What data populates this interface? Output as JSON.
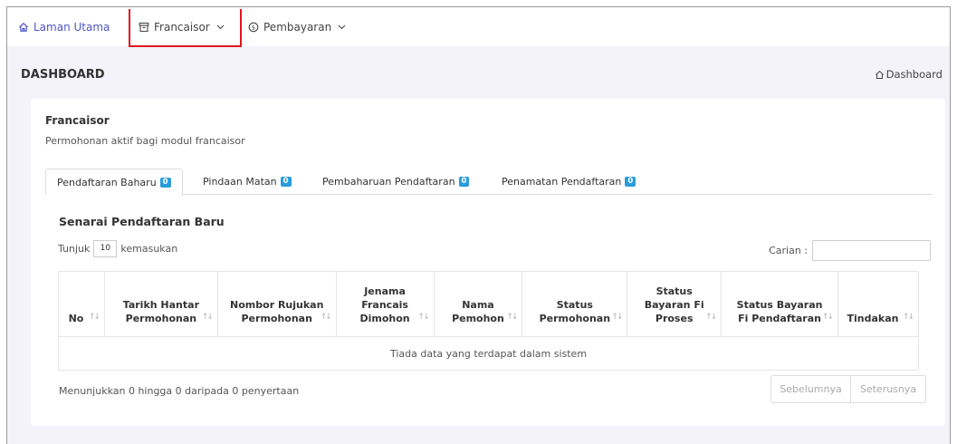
{
  "nav": {
    "home_label": "Laman Utama",
    "francaisor_label": "Francaisor",
    "pembayaran_label": "Pembayaran",
    "accent_color": "#4f55c5",
    "highlight_color": "#e0151e"
  },
  "header": {
    "title": "DASHBOARD",
    "breadcrumb": "Dashboard"
  },
  "card": {
    "title": "Francaisor",
    "subtitle": "Permohonan aktif bagi modul francaisor"
  },
  "tabs": [
    {
      "label": "Pendaftaran Baharu",
      "count": "0",
      "active": true
    },
    {
      "label": "Pindaan Matan",
      "count": "0",
      "active": false
    },
    {
      "label": "Pembaharuan Pendaftaran",
      "count": "0",
      "active": false
    },
    {
      "label": "Penamatan Pendaftaran",
      "count": "0",
      "active": false
    }
  ],
  "section": {
    "title": "Senarai Pendaftaran Baru"
  },
  "length": {
    "prefix": "Tunjuk",
    "value": "10",
    "suffix": "kemasukan"
  },
  "search": {
    "label": "Carian :",
    "value": ""
  },
  "table": {
    "columns": [
      {
        "l1": "",
        "l2": "",
        "l3": "No"
      },
      {
        "l1": "",
        "l2": "Tarikh Hantar",
        "l3": "Permohonan"
      },
      {
        "l1": "",
        "l2": "Nombor Rujukan",
        "l3": "Permohonan"
      },
      {
        "l1": "Jenama",
        "l2": "Francais",
        "l3": "Dimohon"
      },
      {
        "l1": "",
        "l2": "Nama",
        "l3": "Pemohon"
      },
      {
        "l1": "",
        "l2": "Status",
        "l3": "Permohonan"
      },
      {
        "l1": "Status",
        "l2": "Bayaran Fi",
        "l3": "Proses"
      },
      {
        "l1": "",
        "l2": "Status Bayaran",
        "l3": "Fi Pendaftaran"
      },
      {
        "l1": "",
        "l2": "",
        "l3": "Tindakan"
      }
    ],
    "empty_message": "Tiada data yang terdapat dalam sistem"
  },
  "footer": {
    "info": "Menunjukkan 0 hingga 0 daripada 0 penyertaan",
    "prev_label": "Sebelumnya",
    "next_label": "Seterusnya"
  },
  "icons": {
    "home": "home-icon",
    "francaisor": "archive-icon",
    "pembayaran": "dollar-circle-icon",
    "chevron": "chevron-down-icon",
    "sort": "sort-icon"
  }
}
